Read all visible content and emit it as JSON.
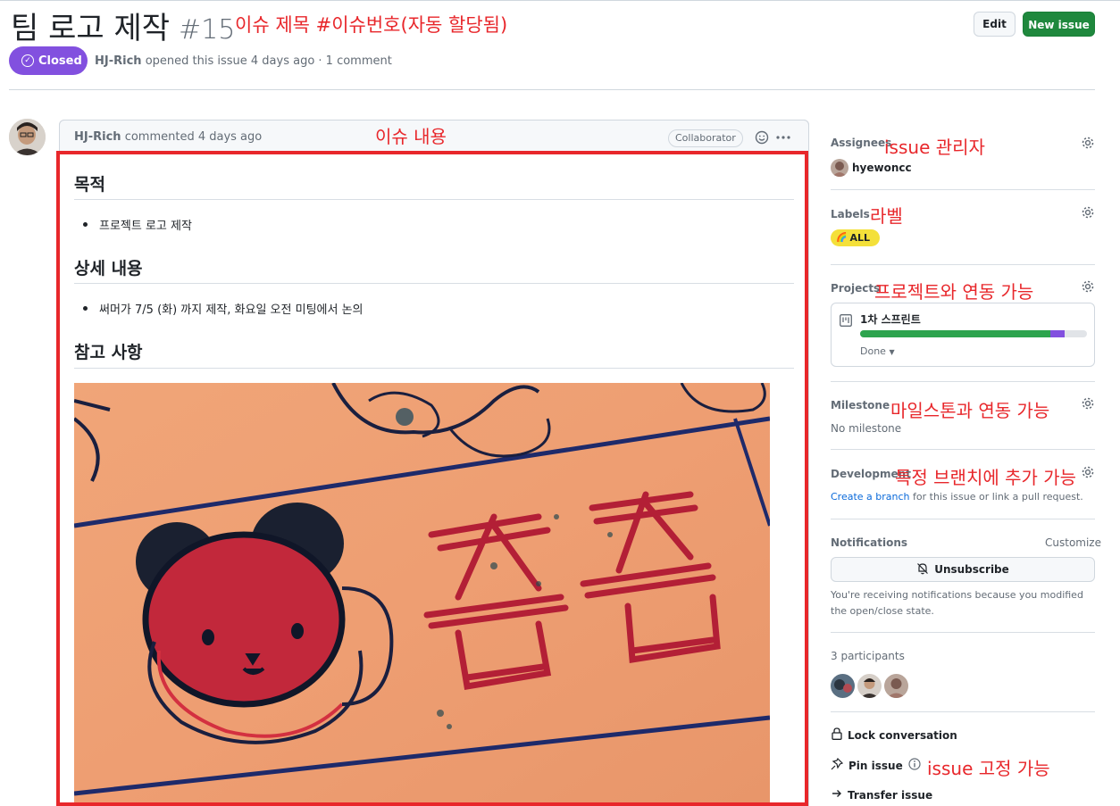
{
  "issue": {
    "title": "팀 로고 제작",
    "number": "#15",
    "state": "Closed",
    "author": "HJ-Rich",
    "opened_text": "opened this issue 4 days ago · 1 comment"
  },
  "buttons": {
    "edit": "Edit",
    "new_issue": "New issue"
  },
  "comment": {
    "author": "HJ-Rich",
    "time_text": "commented 4 days ago",
    "badge": "Collaborator",
    "sections": [
      {
        "heading": "목적",
        "bullet": "프로젝트 로고 제작"
      },
      {
        "heading": "상세 내용",
        "bullet": "써머가 7/5 (화) 까지 제작, 화요일 오전 미팅에서 논의"
      },
      {
        "heading": "참고 사항"
      }
    ]
  },
  "sidebar": {
    "assignees": {
      "title": "Assignees",
      "user": "hyewoncc"
    },
    "labels": {
      "title": "Labels",
      "label": "ALL",
      "label_color": "#f4e03a"
    },
    "projects": {
      "title": "Projects",
      "name": "1차 스프린트",
      "status": "Done",
      "progress_done": 0.84,
      "progress_in_progress": 0.06,
      "done_color": "#2da44e",
      "in_progress_color": "#8250df"
    },
    "milestone": {
      "title": "Milestone",
      "value": "No milestone"
    },
    "development": {
      "title": "Development",
      "link": "Create a branch",
      "rest": " for this issue or link a pull request."
    },
    "notifications": {
      "title": "Notifications",
      "customize": "Customize",
      "button": "Unsubscribe",
      "reason": "You're receiving notifications because you modified the open/close state."
    },
    "participants": {
      "title": "3 participants"
    },
    "actions": {
      "lock": "Lock conversation",
      "pin": "Pin issue",
      "transfer": "Transfer issue"
    }
  },
  "annotations": {
    "title_note": "이슈 제목 #이슈번호(자동 할당됨)",
    "body_note": "이슈 내용",
    "assignee_note": "issue 관리자",
    "labels_note": "라벨",
    "projects_note": "프로젝트와 연동 가능",
    "milestone_note": "마일스톤과 연동 가능",
    "development_note": "특정 브랜치에 추가 가능",
    "pin_note": "issue 고정 가능"
  },
  "colors": {
    "accent": "#e8272b",
    "closed": "#8250df",
    "primary_button": "#1f883d",
    "link": "#0969da"
  }
}
